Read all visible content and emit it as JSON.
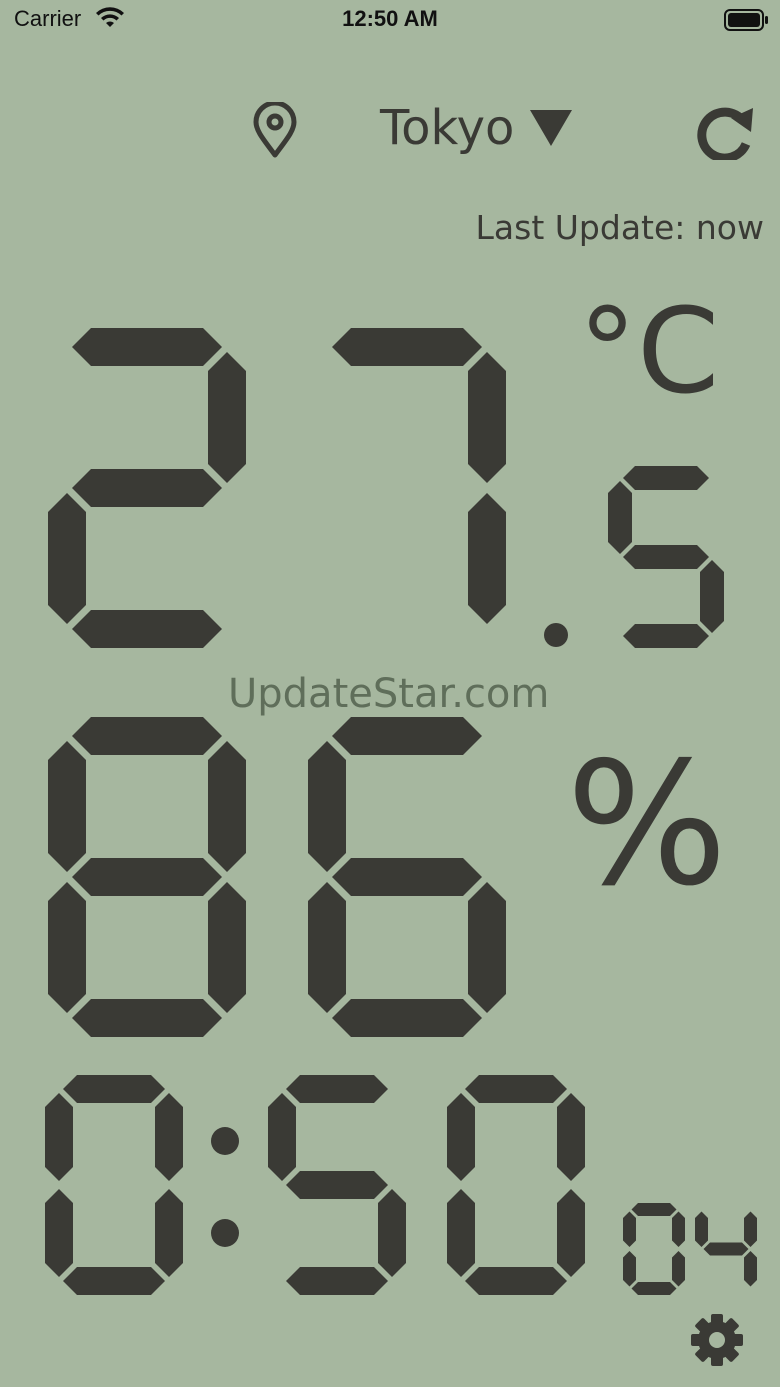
{
  "status_bar": {
    "carrier": "Carrier",
    "time": "12:50 AM"
  },
  "header": {
    "location_icon": "location-pin-icon",
    "city": "Tokyo",
    "dropdown_icon": "triangle-down-icon",
    "refresh_icon": "refresh-icon"
  },
  "last_update": "Last Update: now",
  "temperature": {
    "whole": "27",
    "decimal": "5",
    "unit": "°C"
  },
  "humidity": {
    "value": "86",
    "unit": "%"
  },
  "clock": {
    "hours": "0",
    "minutes": "50",
    "seconds": "04"
  },
  "watermark": "UpdateStar.com",
  "settings_icon": "gear-icon",
  "colors": {
    "background": "#a6b79f",
    "segment": "#3a3a35"
  }
}
